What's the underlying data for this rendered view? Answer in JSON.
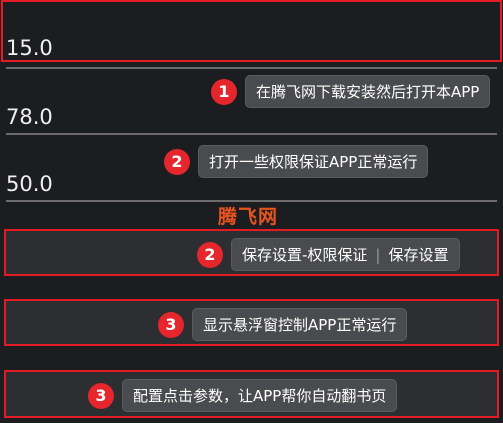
{
  "values": [
    "15.0",
    "78.0",
    "50.0"
  ],
  "brand": "腾飞网",
  "steps": [
    {
      "num": "1",
      "text": "在腾飞网下载安装然后打开本APP"
    },
    {
      "num": "2",
      "text": "打开一些权限保证APP正常运行"
    },
    {
      "num": "2",
      "text_a": "保存设置-权限保证",
      "text_b": "保存设置"
    },
    {
      "num": "3",
      "text": "显示悬浮窗控制APP正常运行"
    },
    {
      "num": "3",
      "text": "配置点击参数，让APP帮你自动翻书页"
    }
  ],
  "colors": {
    "accent": "#e5262d",
    "brand": "#e8541f",
    "background": "#1c1d20"
  }
}
